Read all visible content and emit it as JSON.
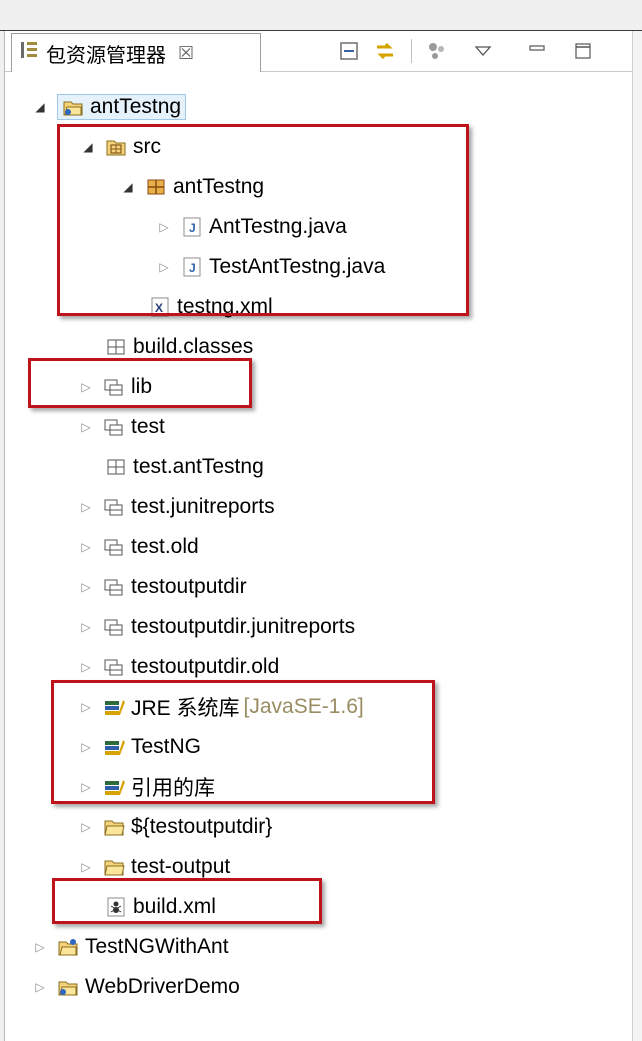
{
  "view": {
    "title": "包资源管理器",
    "close_symbol": "☒"
  },
  "tree": [
    {
      "id": "r0",
      "label": "antTestng",
      "icon": "java-project-icon",
      "expanded": true,
      "selected": true
    },
    {
      "id": "r1",
      "label": "src",
      "icon": "source-folder-icon",
      "expanded": true
    },
    {
      "id": "r2",
      "label": "antTestng",
      "icon": "package-icon",
      "expanded": true
    },
    {
      "id": "r3",
      "label": "AntTestng.java",
      "icon": "java-file-icon",
      "expanded": false
    },
    {
      "id": "r4",
      "label": "TestAntTestng.java",
      "icon": "java-file-icon",
      "expanded": false
    },
    {
      "id": "r5",
      "label": "testng.xml",
      "icon": "xml-file-icon"
    },
    {
      "id": "r6",
      "label": "build.classes",
      "icon": "empty-package-icon"
    },
    {
      "id": "r7",
      "label": "lib",
      "icon": "package-folder-icon",
      "expanded": false
    },
    {
      "id": "r8",
      "label": "test",
      "icon": "package-folder-icon",
      "expanded": false
    },
    {
      "id": "r9",
      "label": "test.antTestng",
      "icon": "empty-package-icon"
    },
    {
      "id": "r10",
      "label": "test.junitreports",
      "icon": "package-folder-icon",
      "expanded": false
    },
    {
      "id": "r11",
      "label": "test.old",
      "icon": "package-folder-icon",
      "expanded": false
    },
    {
      "id": "r12",
      "label": "testoutputdir",
      "icon": "package-folder-icon",
      "expanded": false
    },
    {
      "id": "r13",
      "label": "testoutputdir.junitreports",
      "icon": "package-folder-icon",
      "expanded": false
    },
    {
      "id": "r14",
      "label": "testoutputdir.old",
      "icon": "package-folder-icon",
      "expanded": false
    },
    {
      "id": "r15",
      "label": "JRE 系统库",
      "decoration": "[JavaSE-1.6]",
      "icon": "library-icon",
      "expanded": false
    },
    {
      "id": "r16",
      "label": "TestNG",
      "icon": "library-icon",
      "expanded": false
    },
    {
      "id": "r17",
      "label": "引用的库",
      "icon": "library-icon",
      "expanded": false
    },
    {
      "id": "r18",
      "label": "${testoutputdir}",
      "icon": "folder-icon",
      "expanded": false
    },
    {
      "id": "r19",
      "label": "test-output",
      "icon": "folder-icon",
      "expanded": false
    },
    {
      "id": "r20",
      "label": "build.xml",
      "icon": "ant-file-icon"
    },
    {
      "id": "r21",
      "label": "TestNGWithAnt",
      "icon": "java-project-icon",
      "expanded": false
    },
    {
      "id": "r22",
      "label": "WebDriverDemo",
      "icon": "java-project-icon",
      "expanded": false
    }
  ],
  "colors": {
    "highlight": "#c0121b",
    "decoration": "#9a8c62",
    "selection": "#e5f1fb"
  }
}
